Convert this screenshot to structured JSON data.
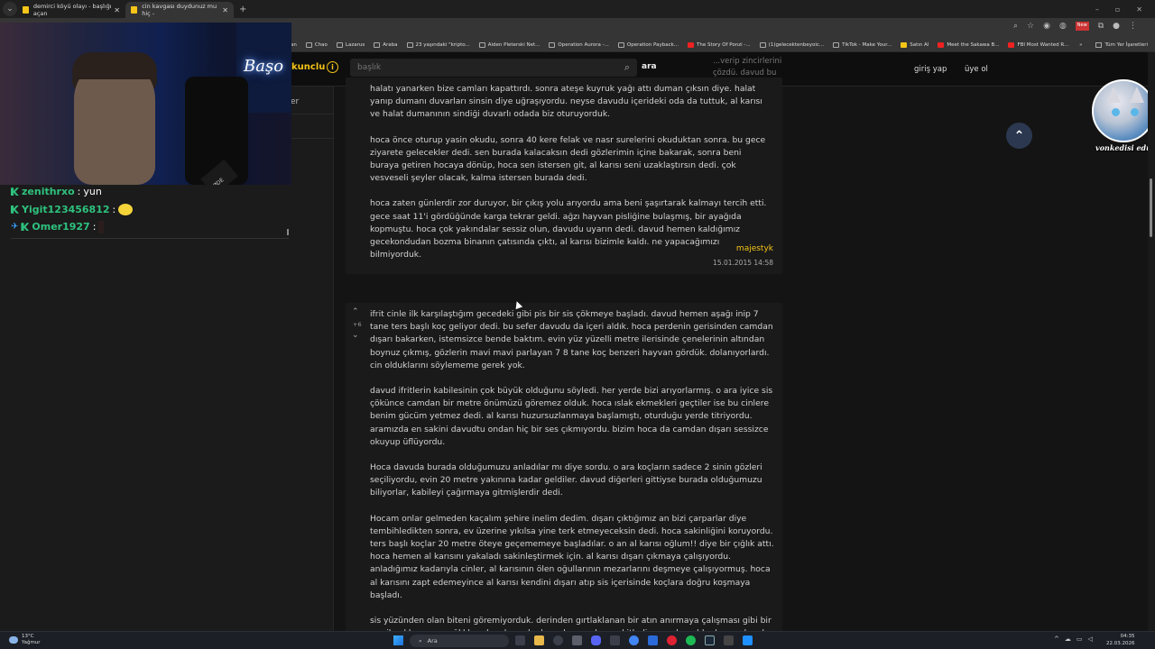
{
  "browser": {
    "tabs": [
      {
        "title": "demirci köyü olayı - başlığı açan",
        "active": false
      },
      {
        "title": "cin kavgası duydunuz mu hiç -",
        "active": true
      }
    ],
    "bookmarks": [
      "an",
      "Chao",
      "Lazarus",
      "Araba",
      "23 yaşındaki \"kripto...",
      "Aiden Pleterski Net...",
      "Operation Aurora -...",
      "Operation Payback...",
      "The Story Of Ponzi -...",
      "(1)gelecektenbeyoic...",
      "TikTok - Make Your...",
      "Satın Al",
      "Meet the Sakawa B...",
      "FBI Most Wanted R..."
    ],
    "bookmarks_overflow": "»",
    "all_bookmarks": "Tüm Yer İşaretleri",
    "new_badge": "New"
  },
  "site": {
    "brand_fragment": "kunclu",
    "info_icon": "i",
    "search_placeholder": "başlık",
    "search_button": "ara",
    "header_overflow_text": "...verip zincirlerini çözdü. davud bu ...evin düğümlü halat koruyormuş.",
    "login": "giriş yap",
    "signup": "üye ol",
    "left_fragment": "er"
  },
  "entries": [
    {
      "paragraphs": [
        "halatı yanarken bize camları kapattırdı. sonra ateşe kuyruk yağı attı duman çıksın diye. halat yanıp dumanı duvarları sinsin diye uğraşıyordu. neyse davudu içerideki oda da tuttuk, al karısı ve halat dumanının sindiği duvarlı odada biz oturuyorduk.",
        "hoca önce oturup yasin okudu, sonra 40 kere felak ve nasr surelerini okuduktan sonra. bu gece ziyarete gelecekler dedi. sen burada kalacaksın dedi gözlerimin içine bakarak, sonra beni buraya getiren hocaya dönüp, hoca sen istersen git, al karısı seni uzaklaştırsın dedi. çok vesveseli şeyler olacak, kalma istersen burada dedi.",
        "hoca zaten günlerdir zor duruyor, bir çıkış yolu arıyordu ama beni şaşırtarak kalmayı tercih etti. gece saat 11'i gördüğünde karga tekrar geldi. ağzı hayvan pisliğine bulaşmış, bir ayağıda kopmuştu. hoca çok yakındalar sessiz olun, davudu uyarın dedi. davud hemen kaldığımız gecekondudan bozma binanın çatısında çıktı, al karısı bizimle kaldı. ne yapacağımızı bilmiyorduk."
      ],
      "author": "majestyk",
      "date": "15.01.2015 14:58"
    },
    {
      "vote_up": "⌃",
      "vote_count": "+6",
      "vote_down": "⌄",
      "paragraphs": [
        "ifrit cinle ilk karşılaştığım gecedeki gibi pis bir sis çökmeye başladı. davud hemen aşağı inip 7 tane ters başlı koç geliyor dedi. bu sefer davudu da içeri aldık. hoca perdenin gerisinden camdan dışarı bakarken, istemsizce bende baktım. evin yüz yüzelli metre ilerisinde çenelerinin altından boynuz çıkmış, gözlerin mavi mavi parlayan 7 8 tane koç benzeri hayvan gördük. dolanıyorlardı. cin olduklarını söylememe gerek yok.",
        "davud ifritlerin kabilesinin çok büyük olduğunu söyledi. her yerde bizi arıyorlarmış. o ara iyice sis çökünce camdan bir metre önümüzü göremez olduk. hoca ıslak ekmekleri geçtiler ise bu cinlere benim gücüm yetmez dedi. al karısı huzursuzlanmaya başlamıştı, oturduğu yerde titriyordu. aramızda en sakini davudtu ondan hiç bir ses çıkmıyordu. bizim hoca da camdan dışarı sessizce okuyup üflüyordu.",
        "Hoca davuda burada olduğumuzu anladılar mı diye sordu. o ara koçların sadece 2 sinin gözleri seçiliyordu, evin 20 metre yakınına kadar geldiler. davud diğerleri gittiyse burada olduğumuzu biliyorlar, kabileyi çağırmaya gitmişlerdir dedi.",
        "Hocam onlar gelmeden kaçalım şehire inelim dedim. dışarı çıktığımız an bizi çarparlar diye tembihledikten sonra, ev üzerine yıkılsa yine terk etmeyeceksin dedi. hoca sakinliğini koruyordu. ters başlı koçlar 20 metre öteye geçememeye başladılar. o an al karısı oğlum!! diye bir çığlık attı. hoca hemen al karısını yakaladı sakinleştirmek için. al karısı dışarı çıkmaya çalışıyordu. anladığımız kadarıyla cinler, al karısının ölen oğullarının mezarlarını deşmeye çalışıyormuş. hoca al karısını zapt edemeyince al karısı kendini dışarı atıp sis içerisinde koçlara doğru koşmaya başladı.",
        "sis yüzünden olan biteni göremiyorduk. derinden gırtlaklanan bir atın anırmaya çalışması gibi bir ses ile al karısının çığlıkları duyuluyordu. hoca hemen kapıyı kitledi. o an davudda dışarı çıkmak"
      ]
    }
  ],
  "stream": {
    "neon_sign": "Başo",
    "mic_label": "RØDE",
    "chat": [
      {
        "user": "zenithrxo",
        "message": "yun",
        "badge": true,
        "pinned": false,
        "emote": false
      },
      {
        "user": "Yigit123456812",
        "message": "",
        "badge": true,
        "pinned": false,
        "emote": true
      },
      {
        "user": "Omer1927",
        "message": "",
        "badge": true,
        "pinned": true,
        "emote": false
      }
    ],
    "cat_caption": "vonkedisi edu"
  },
  "taskbar": {
    "weather_temp": "13°C",
    "weather_desc": "Yağmur",
    "search_label": "Ara",
    "time": "04:35",
    "date": "22.03.2026"
  },
  "colors": {
    "accent": "#f5c518",
    "chat_user": "#2ec27e",
    "background": "#141414"
  }
}
